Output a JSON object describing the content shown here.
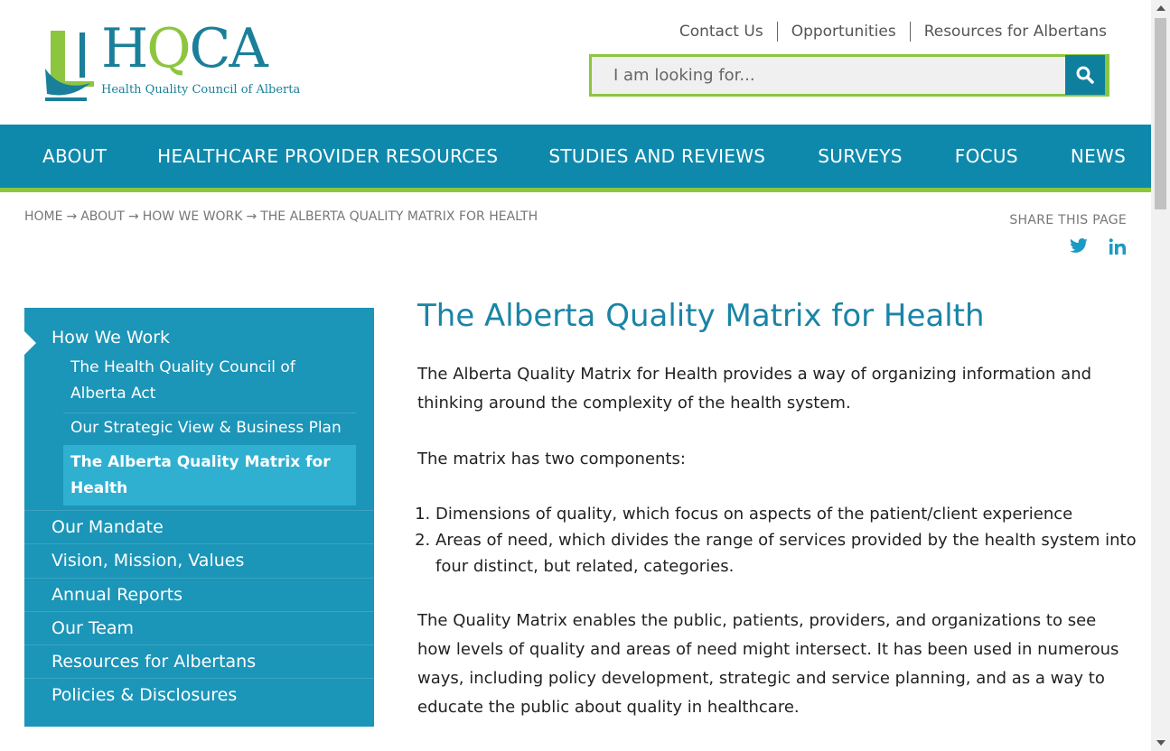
{
  "logo": {
    "wordmark_h": "H",
    "wordmark_q": "Q",
    "wordmark_ca": "CA",
    "subtitle": "Health Quality Council of Alberta"
  },
  "utility_links": [
    "Contact Us",
    "Opportunities",
    "Resources for Albertans"
  ],
  "search": {
    "placeholder": "I am looking for..."
  },
  "nav": [
    "ABOUT",
    "HEALTHCARE PROVIDER RESOURCES",
    "STUDIES AND REVIEWS",
    "SURVEYS",
    "FOCUS",
    "NEWS"
  ],
  "breadcrumb": [
    "HOME",
    "ABOUT",
    "HOW WE WORK",
    "THE ALBERTA QUALITY MATRIX FOR HEALTH"
  ],
  "breadcrumb_sep": "→",
  "share": {
    "label": "SHARE THIS PAGE",
    "icons": [
      "twitter-icon",
      "linkedin-icon"
    ]
  },
  "sidebar": {
    "heading": "How We Work",
    "sub_items": [
      "The Health Quality Council of Alberta Act",
      "Our Strategic View & Business Plan",
      "The Alberta Quality Matrix for Health"
    ],
    "items": [
      "Our Mandate",
      "Vision, Mission, Values",
      "Annual Reports",
      "Our Team",
      "Resources for Albertans",
      "Policies & Disclosures"
    ]
  },
  "main": {
    "title": "The Alberta Quality Matrix for Health",
    "p1": "The Alberta Quality Matrix for Health provides a way of organizing information and thinking around the complexity of the health system.",
    "p2": "The matrix has two components:",
    "list": [
      "Dimensions of quality, which focus on aspects of the patient/client experience",
      "Areas of need, which divides the range of services provided by the health system into four distinct, but related, categories."
    ],
    "p3": "The Quality Matrix enables the public, patients, providers, and organizations to see how levels of quality and areas of need might intersect. It has been used in numerous ways, including policy development, strategic and service planning, and as a way to educate the public about quality in healthcare."
  },
  "colors": {
    "brand_blue": "#0f89ab",
    "brand_green": "#8cc63f",
    "sidebar_blue": "#1b95b8",
    "sidebar_active": "#2fb0d1",
    "title_blue": "#1a84a6"
  }
}
